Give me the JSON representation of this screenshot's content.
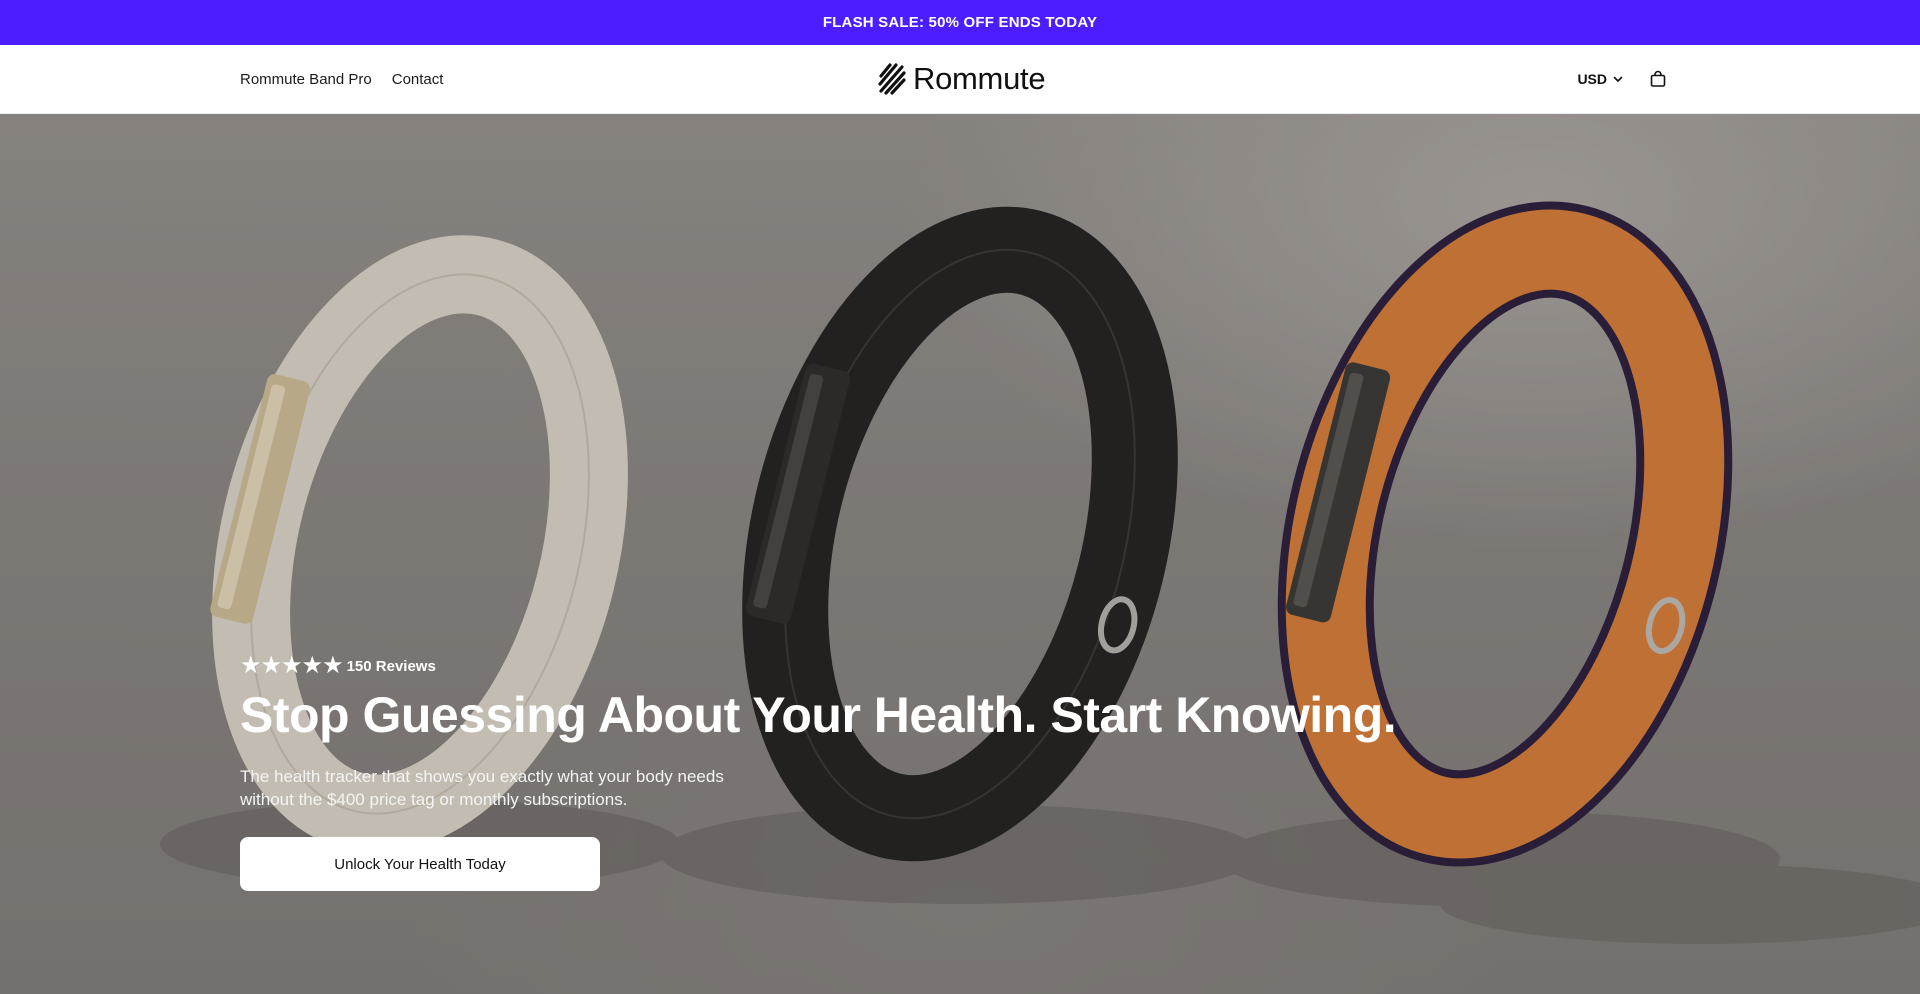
{
  "announcement": {
    "text": "FLASH SALE: 50% OFF ENDS TODAY"
  },
  "nav": {
    "items": [
      {
        "label": "Rommute Band Pro"
      },
      {
        "label": "Contact"
      }
    ]
  },
  "logo": {
    "text": "Rommute",
    "icon": "striped-logo-mark"
  },
  "header_right": {
    "currency": "USD",
    "currency_icon": "chevron-down-icon",
    "cart_icon": "shopping-bag-icon"
  },
  "hero": {
    "rating": {
      "stars": "★★★★★",
      "count": 5,
      "reviews": "150 Reviews"
    },
    "headline": "Stop Guessing About Your Health. Start Knowing.",
    "subtext_line1": "The health tracker that shows you exactly what your body needs",
    "subtext_line2": "without the $400 price tag or monthly subscriptions.",
    "cta": "Unlock Your Health Today"
  },
  "colors": {
    "announcement_bg": "#4b1dff",
    "band_cream": "#e4ddd0",
    "band_black": "#1f1f1d",
    "band_orange": "#e0823a",
    "band_trim": "#2a1d3d"
  }
}
